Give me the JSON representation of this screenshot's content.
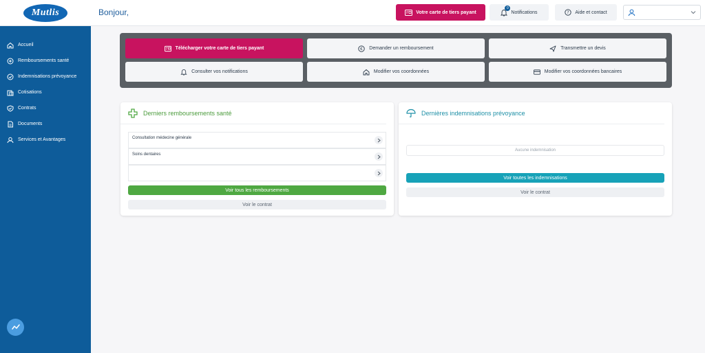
{
  "brand": {
    "logo_text": "Mutlis",
    "accent": "#c8135f",
    "sidebar_color": "#0e5c9a"
  },
  "sidebar": {
    "items": [
      {
        "label": "Accueil",
        "icon": "home-icon"
      },
      {
        "label": "Remboursements santé",
        "icon": "health-icon"
      },
      {
        "label": "Indemnisations prévoyance",
        "icon": "shield-plus-icon"
      },
      {
        "label": "Cotisations",
        "icon": "wallet-icon"
      },
      {
        "label": "Contrats",
        "icon": "shield-check-icon"
      },
      {
        "label": "Documents",
        "icon": "document-icon"
      },
      {
        "label": "Services et Avantages",
        "icon": "services-icon"
      }
    ]
  },
  "header": {
    "greeting": "Bonjour,",
    "card_button": "Votre carte de tiers payant",
    "notifications_label": "Notifications",
    "notifications_count": "0",
    "help_label": "Aide et contact",
    "user_value": ""
  },
  "actions": [
    {
      "label": "Télécharger votre carte de tiers payant",
      "icon": "card-icon"
    },
    {
      "label": "Demander un remboursement",
      "icon": "euro-icon"
    },
    {
      "label": "Transmettre un devis",
      "icon": "send-icon"
    },
    {
      "label": "Consulter vos notifications",
      "icon": "bell-icon"
    },
    {
      "label": "Modifier vos coordonnées",
      "icon": "house-icon"
    },
    {
      "label": "Modifier vos coordonnées bancaires",
      "icon": "credit-card-icon"
    }
  ],
  "health": {
    "title": "Derniers remboursements santé",
    "rows": [
      "Consultation médecine générale",
      "Soins dentaires",
      ""
    ],
    "all_button": "Voir tous les remboursements",
    "contract_button": "Voir le contrat"
  },
  "provident": {
    "title": "Dernières indemnisations prévoyance",
    "empty": "Aucune indemnisation",
    "all_button": "Voir toutes les indemnisations",
    "contract_button": "Voir le contrat"
  }
}
